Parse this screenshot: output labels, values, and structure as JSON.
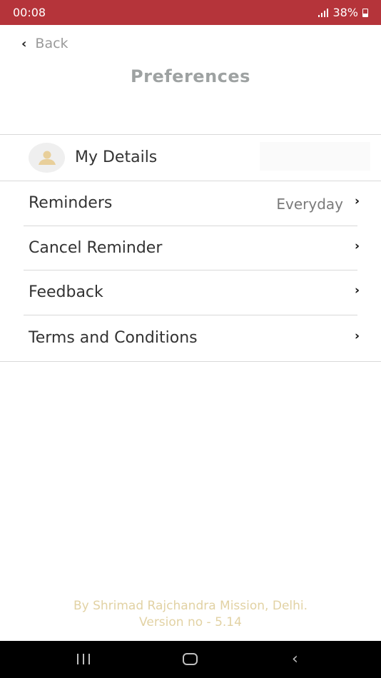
{
  "status_bar": {
    "time": "00:08",
    "battery": "38%",
    "background": "#b5343a"
  },
  "header": {
    "back_label": "Back",
    "title": "Preferences"
  },
  "profile": {
    "label": "My Details",
    "icon": "person-icon"
  },
  "menu": {
    "items": [
      {
        "label": "Reminders",
        "value": "Everyday"
      },
      {
        "label": "Cancel Reminder",
        "value": ""
      },
      {
        "label": "Feedback",
        "value": ""
      },
      {
        "label": "Terms and Conditions",
        "value": ""
      }
    ]
  },
  "footer": {
    "line1": "By Shrimad Rajchandra Mission, Delhi.",
    "line2": "Version no - 5.14"
  },
  "colors": {
    "accent": "#b5343a",
    "title": "#9ea2a2",
    "footer_text": "#e2d2a4"
  }
}
